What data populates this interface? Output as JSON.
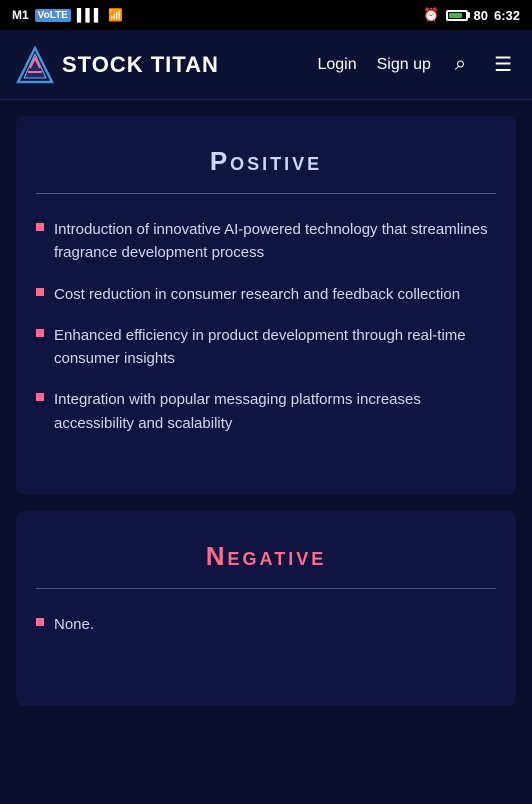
{
  "statusBar": {
    "carrier": "M1",
    "volte": "VoLTE",
    "signal": "signal",
    "wifi": "wifi",
    "alarm": "alarm",
    "battery": "80",
    "time": "6:32"
  },
  "navbar": {
    "logoText": "STOCK TITAN",
    "loginLabel": "Login",
    "signupLabel": "Sign up",
    "searchAriaLabel": "Search",
    "menuAriaLabel": "Menu"
  },
  "positive": {
    "title": "Positive",
    "items": [
      "Introduction of innovative AI-powered technology that streamlines fragrance development process",
      "Cost reduction in consumer research and feedback collection",
      "Enhanced efficiency in product development through real-time consumer insights",
      "Integration with popular messaging platforms increases accessibility and scalability"
    ]
  },
  "negative": {
    "title": "Negative",
    "items": [
      "None."
    ]
  }
}
